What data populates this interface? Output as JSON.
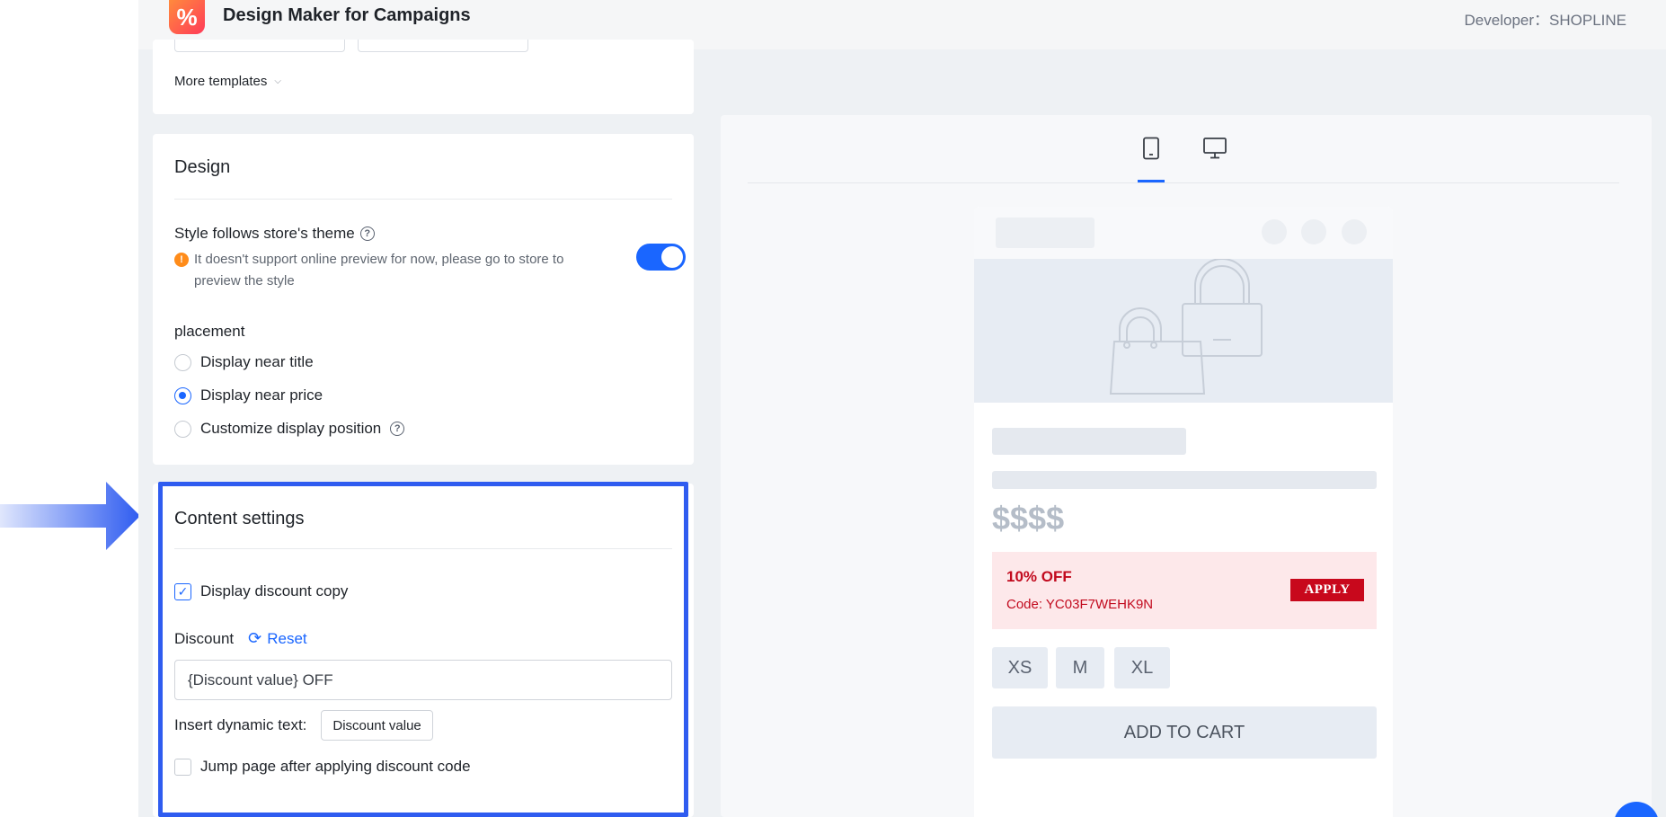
{
  "header": {
    "logo_glyph": "%",
    "app_title": "Design Maker for Campaigns",
    "developer": "Developer：SHOPLINE"
  },
  "templates": {
    "more_label": "More templates"
  },
  "design": {
    "title": "Design",
    "style_label": "Style follows store's theme",
    "style_notice": "It doesn't support online preview for now, please go to store to preview the style",
    "style_toggle_on": true,
    "placement_label": "placement",
    "options": [
      {
        "label": "Display near title",
        "selected": false
      },
      {
        "label": "Display near price",
        "selected": true
      },
      {
        "label": "Customize display position",
        "selected": false
      }
    ]
  },
  "content": {
    "title": "Content settings",
    "display_copy_label": "Display discount copy",
    "display_copy_checked": true,
    "discount_label": "Discount",
    "reset_label": "Reset",
    "discount_value": "{Discount value} OFF",
    "insert_label": "Insert dynamic text:",
    "dynamic_button": "Discount value",
    "jump_label": "Jump page after applying discount code",
    "jump_checked": false
  },
  "preview": {
    "price": "$$$$",
    "promo_title": "10% OFF",
    "promo_code": "Code: YC03F7WEHK9N",
    "apply": "APPLY",
    "sizes": [
      "XS",
      "M",
      "XL"
    ],
    "cart": "ADD TO CART"
  },
  "colors": {
    "accent": "#1a66ff",
    "highlight": "#2f5cf0",
    "promo_red": "#c8081c"
  }
}
